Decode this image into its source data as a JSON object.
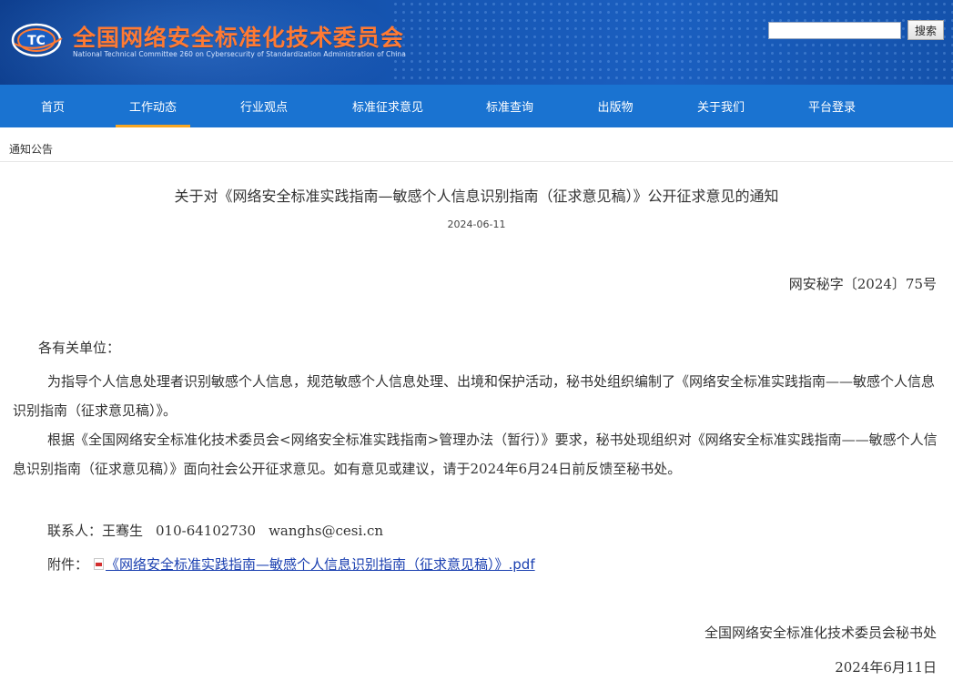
{
  "header": {
    "site_title": "全国网络安全标准化技术委员会",
    "site_subtitle": "National Technical Committee 260 on Cybersecurity of Standardization Administration of China",
    "logo_text": "TC",
    "search_placeholder": "",
    "search_button": "搜索"
  },
  "nav": {
    "items": [
      {
        "label": "首页"
      },
      {
        "label": "工作动态"
      },
      {
        "label": "行业观点"
      },
      {
        "label": "标准征求意见"
      },
      {
        "label": "标准查询"
      },
      {
        "label": "出版物"
      },
      {
        "label": "关于我们"
      },
      {
        "label": "平台登录"
      }
    ],
    "active": "工作动态"
  },
  "breadcrumb": "通知公告",
  "article": {
    "title": "关于对《网络安全标准实践指南—敏感个人信息识别指南（征求意见稿）》公开征求意见的通知",
    "date": "2024-06-11",
    "doc_number": "网安秘字〔2024〕75号",
    "salutation": "各有关单位：",
    "para1": "为指导个人信息处理者识别敏感个人信息，规范敏感个人信息处理、出境和保护活动，秘书处组织编制了《网络安全标准实践指南——敏感个人信息识别指南（征求意见稿）》。",
    "para2": "根据《全国网络安全标准化技术委员会<网络安全标准实践指南>管理办法（暂行）》要求，秘书处现组织对《网络安全标准实践指南——敏感个人信息识别指南（征求意见稿）》面向社会公开征求意见。如有意见或建议，请于2024年6月24日前反馈至秘书处。",
    "contact_label": "联系人：王骞生",
    "contact_phone": "010-64102730",
    "contact_email": "wanghs@cesi.cn",
    "attachment_label": "附件：",
    "attachment_link": "《网络安全标准实践指南—敏感个人信息识别指南（征求意见稿）》.pdf",
    "signature_org": "全国网络安全标准化技术委员会秘书处",
    "signature_date": "2024年6月11日"
  },
  "colors": {
    "banner": "#1656b3",
    "nav": "#1a73d1",
    "active_underline": "#f6a623",
    "title_orange": "#ff7a33",
    "link": "#1a3fb0"
  }
}
